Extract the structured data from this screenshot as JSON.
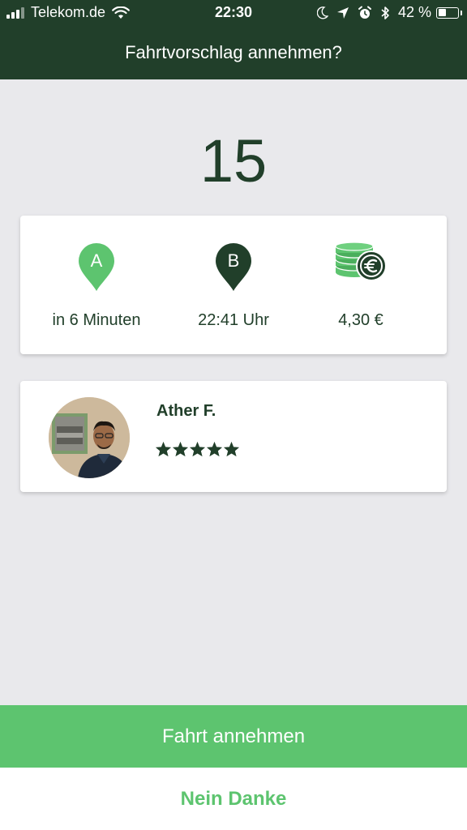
{
  "status_bar": {
    "carrier": "Telekom.de",
    "time": "22:30",
    "battery_percent": "42 %",
    "battery_level": 0.42,
    "icons": [
      "signal-icon",
      "wifi-icon",
      "moon-icon",
      "location-arrow-icon",
      "alarm-icon",
      "bluetooth-icon",
      "battery-icon"
    ]
  },
  "header": {
    "title": "Fahrtvorschlag annehmen?"
  },
  "countdown": "15",
  "trip": {
    "pickup": {
      "marker": "A",
      "label": "in 6 Minuten",
      "icon": "pickup-pin-icon",
      "color": "#5dc46f"
    },
    "dropoff": {
      "marker": "B",
      "label": "22:41 Uhr",
      "icon": "dropoff-pin-icon",
      "color": "#213f2a"
    },
    "price": {
      "label": "4,30 €",
      "icon": "euro-coins-icon"
    }
  },
  "driver": {
    "name": "Ather F.",
    "rating": 5,
    "rating_max": 5
  },
  "actions": {
    "accept_label": "Fahrt annehmen",
    "decline_label": "Nein Danke"
  },
  "colors": {
    "header_bg": "#213f2a",
    "accent_green": "#5dc46f",
    "dark_green": "#213f2a",
    "background": "#e9e9ec"
  }
}
